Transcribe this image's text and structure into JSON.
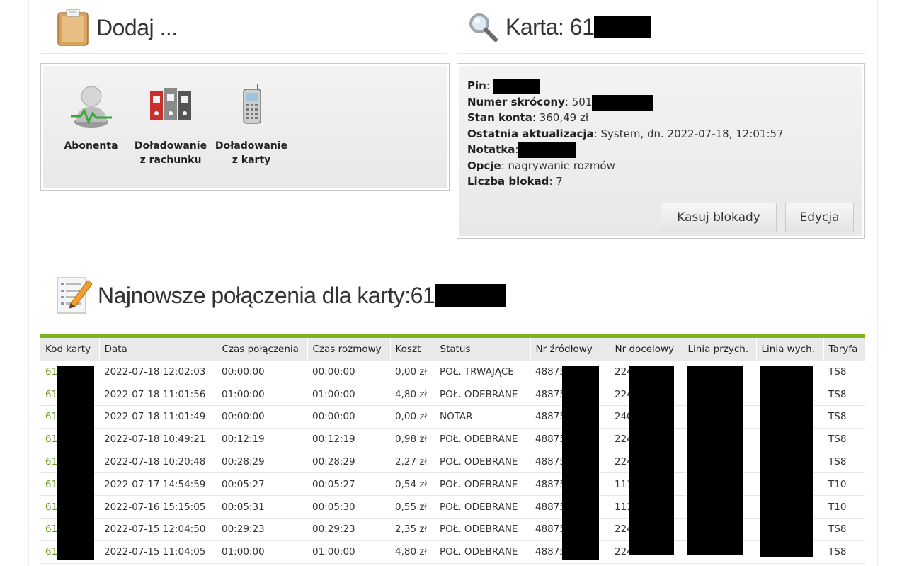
{
  "add_section": {
    "title": "Dodaj ...",
    "items": [
      {
        "label_line1": "Abonenta",
        "label_line2": "",
        "icon": "subscriber-icon"
      },
      {
        "label_line1": "Doładowanie",
        "label_line2": "z rachunku",
        "icon": "binders-icon"
      },
      {
        "label_line1": "Doładowanie",
        "label_line2": "z karty",
        "icon": "phone-icon"
      }
    ]
  },
  "card_section": {
    "title": "Karta: 61",
    "fields": [
      {
        "label": "Pin",
        "value": ""
      },
      {
        "label": "Numer skrócony",
        "value": "501"
      },
      {
        "label": "Stan konta",
        "value": "360,49 zł"
      },
      {
        "label": "Ostatnia aktualizacja",
        "value": "System, dn. 2022-07-18, 12:01:57"
      },
      {
        "label": "Notatka",
        "value": ""
      },
      {
        "label": "Opcje",
        "value": "nagrywanie rozmów"
      },
      {
        "label": "Liczba blokad",
        "value": "7"
      }
    ],
    "buttons": {
      "clear_locks": "Kasuj blokady",
      "edit": "Edycja"
    }
  },
  "calls_section": {
    "title": "Najnowsze połączenia dla karty:61",
    "columns": [
      "Kod karty",
      "Data",
      "Czas połączenia",
      "Czas rozmowy",
      "Koszt",
      "Status",
      "Nr źródłowy",
      "Nr docelowy",
      "Linia przych.",
      "Linia wych.",
      "Taryfa"
    ],
    "rows": [
      [
        "61",
        "2022-07-18 12:02:03",
        "00:00:00",
        "00:00:00",
        "0,00 zł",
        "POŁ. TRWAJĄCE",
        "48875",
        "224",
        "",
        "",
        "TS8"
      ],
      [
        "61",
        "2022-07-18 11:01:56",
        "01:00:00",
        "01:00:00",
        "4,80 zł",
        "POŁ. ODEBRANE",
        "48875",
        "224",
        "",
        "",
        "TS8"
      ],
      [
        "61",
        "2022-07-18 11:01:49",
        "00:00:00",
        "00:00:00",
        "0,00 zł",
        "NOTAR",
        "48875",
        "240",
        "",
        "",
        "TS8"
      ],
      [
        "61",
        "2022-07-18 10:49:21",
        "00:12:19",
        "00:12:19",
        "0,98 zł",
        "POŁ. ODEBRANE",
        "48875",
        "224",
        "",
        "",
        "TS8"
      ],
      [
        "61",
        "2022-07-18 10:20:48",
        "00:28:29",
        "00:28:29",
        "2,27 zł",
        "POŁ. ODEBRANE",
        "48875",
        "224",
        "",
        "",
        "TS8"
      ],
      [
        "61",
        "2022-07-17 14:54:59",
        "00:05:27",
        "00:05:27",
        "0,54 zł",
        "POŁ. ODEBRANE",
        "48875",
        "111",
        "",
        "",
        "T10"
      ],
      [
        "61",
        "2022-07-16 15:15:05",
        "00:05:31",
        "00:05:30",
        "0,55 zł",
        "POŁ. ODEBRANE",
        "48875",
        "111",
        "",
        "",
        "T10"
      ],
      [
        "61",
        "2022-07-15 12:04:50",
        "00:29:23",
        "00:29:23",
        "2,35 zł",
        "POŁ. ODEBRANE",
        "48875",
        "224",
        "",
        "",
        "TS8"
      ],
      [
        "61",
        "2022-07-15 11:04:05",
        "01:00:00",
        "01:00:00",
        "4,80 zł",
        "POŁ. ODEBRANE",
        "48875",
        "224",
        "",
        "",
        "TS8"
      ]
    ]
  },
  "colors": {
    "accent_green": "#7ab51d",
    "card_code_green": "#6a9a1f"
  }
}
